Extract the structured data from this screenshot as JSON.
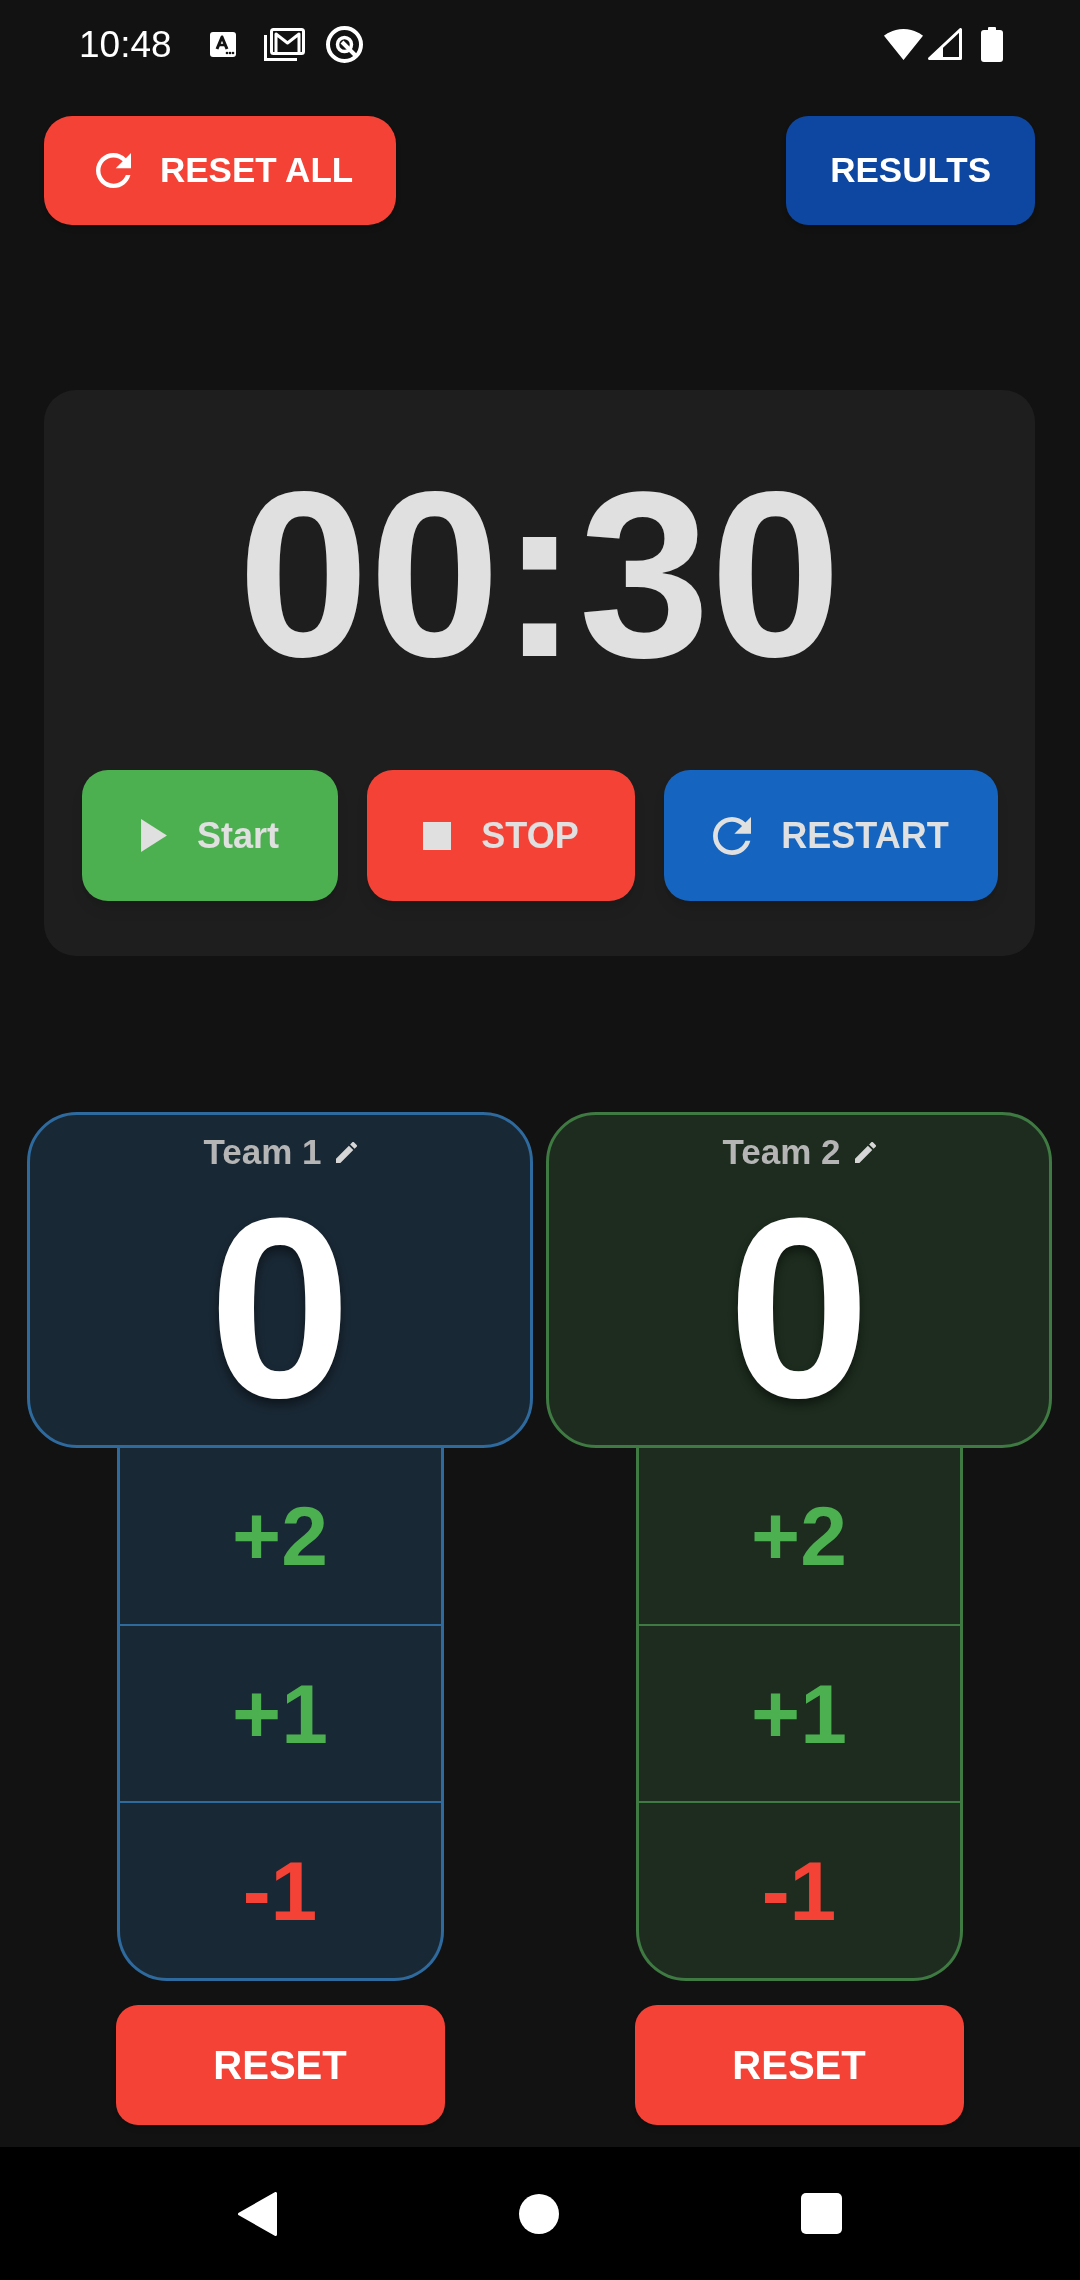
{
  "status_bar": {
    "time": "10:48"
  },
  "header": {
    "reset_all": {
      "label": "RESET ALL"
    },
    "results": {
      "label": "RESULTS"
    }
  },
  "timer": {
    "time": "00:30",
    "controls": [
      {
        "kind": "start",
        "label": "Start"
      },
      {
        "kind": "stop",
        "label": "STOP"
      },
      {
        "kind": "restart",
        "label": "RESTART"
      }
    ]
  },
  "teams": [
    {
      "name": "Team 1",
      "color": "#2e6a9e",
      "score": "0",
      "adjustments": [
        {
          "kind": "add",
          "label": "+2"
        },
        {
          "kind": "add",
          "label": "+1"
        },
        {
          "kind": "subtract",
          "label": "-1"
        }
      ],
      "reset": {
        "label": "RESET"
      }
    },
    {
      "name": "Team 2",
      "color": "#3e7a42",
      "score": "0",
      "adjustments": [
        {
          "kind": "add",
          "label": "+2"
        },
        {
          "kind": "add",
          "label": "+1"
        },
        {
          "kind": "subtract",
          "label": "-1"
        }
      ],
      "reset": {
        "label": "RESET"
      }
    }
  ]
}
